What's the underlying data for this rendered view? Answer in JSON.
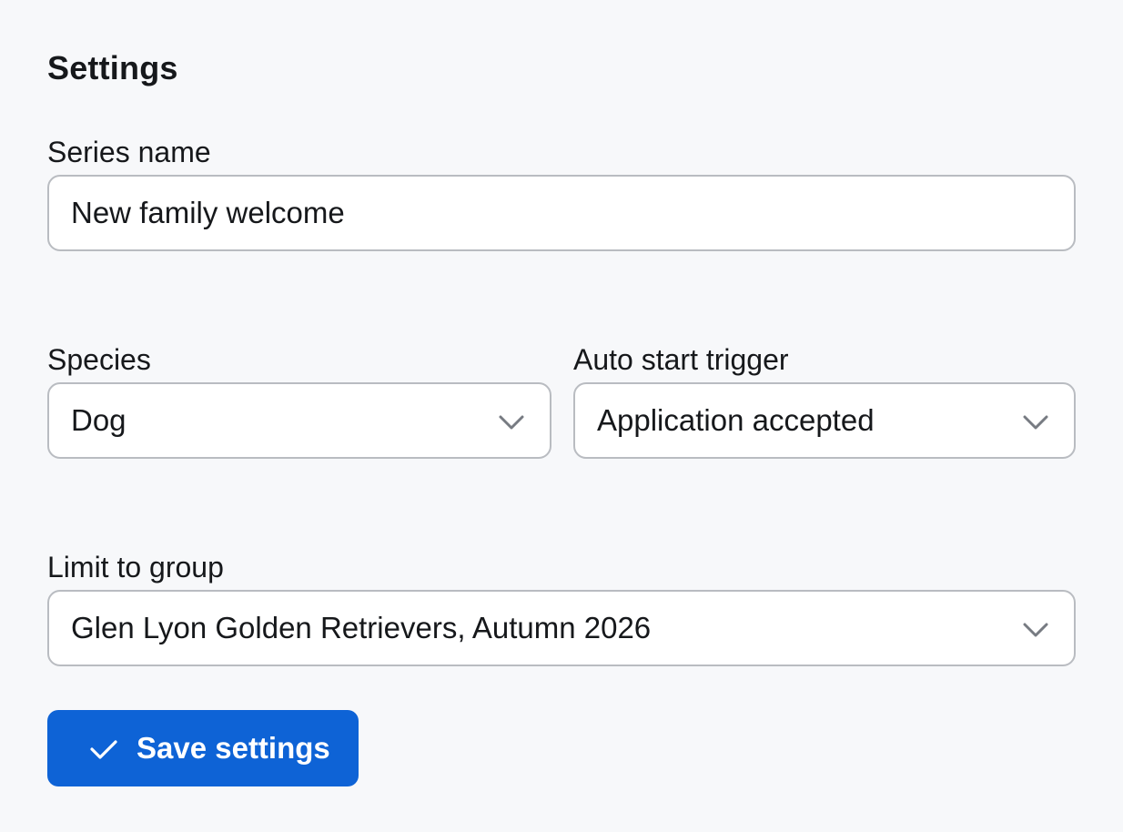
{
  "settings": {
    "title": "Settings",
    "series_name": {
      "label": "Series name",
      "value": "New family welcome"
    },
    "species": {
      "label": "Species",
      "value": "Dog",
      "icon": "chevron-down-icon"
    },
    "auto_start_trigger": {
      "label": "Auto start trigger",
      "value": "Application accepted",
      "icon": "chevron-down-icon"
    },
    "limit_to_group": {
      "label": "Limit to group",
      "value": "Glen Lyon Golden Retrievers, Autumn 2026",
      "icon": "chevron-down-icon"
    },
    "save_button": {
      "label": "Save settings",
      "icon": "check-icon"
    },
    "colors": {
      "background": "#f7f8fa",
      "primary": "#0e63d6",
      "border": "#b9bcc1",
      "text": "#16181b"
    }
  }
}
